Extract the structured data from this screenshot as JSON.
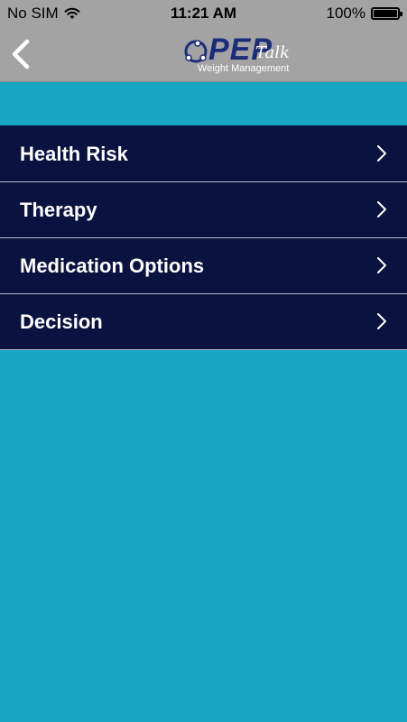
{
  "status_bar": {
    "carrier": "No SIM",
    "time": "11:21 AM",
    "battery": "100%",
    "wifi_icon": "wifi-icon",
    "battery_icon": "battery-icon"
  },
  "nav": {
    "back_icon": "chevron-left-icon",
    "logo_main": "PEP",
    "logo_script": "Talk",
    "logo_sub": "Weight Management"
  },
  "menu": {
    "items": [
      {
        "label": "Health Risk"
      },
      {
        "label": "Therapy"
      },
      {
        "label": "Medication Options"
      },
      {
        "label": "Decision"
      }
    ]
  },
  "colors": {
    "background": "#17a6c3",
    "bar": "#a3a3a3",
    "menu_bg": "#0a1240",
    "logo_blue": "#1d2c7a"
  }
}
